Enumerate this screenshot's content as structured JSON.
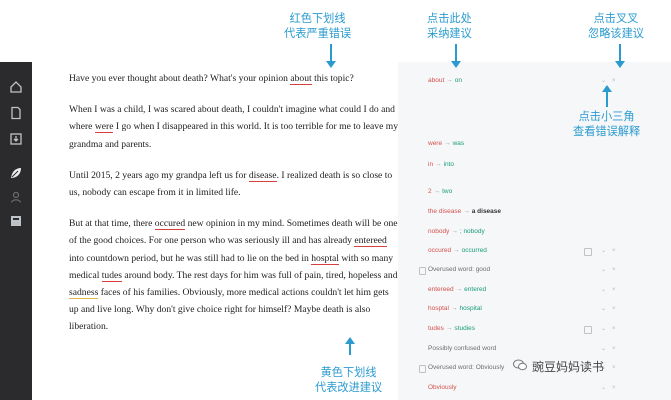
{
  "annotations": {
    "red_underline": [
      "红色下划线",
      "代表严重错误"
    ],
    "accept": [
      "点击此处",
      "采纳建议"
    ],
    "ignore": [
      "点击叉叉",
      "忽略该建议"
    ],
    "triangle": [
      "点击小三角",
      "查看错误解释"
    ],
    "yellow_underline": [
      "黄色下划线",
      "代表改进建议"
    ]
  },
  "paragraphs": [
    [
      "Have you ever thought about death? What's your opinion ",
      "about",
      " this topic?"
    ],
    [
      "When I was a child, I was scared about death, I couldn't imagine what could I do and where ",
      "were",
      " I go when I disappeared in this world. It is too terrible for me to leave my grandma and parents."
    ],
    [
      "Until 2015, 2 years ago my grandpa left us for ",
      "disease",
      ". I realized death is so close to us, nobody can escape from it in limited life."
    ],
    [
      "But at that time, there ",
      "occured",
      " new opinion in my mind. Sometimes death will be one of the good choices. For one person who was seriously ill and has already ",
      "entereed",
      " into countdown period, but he was still had to lie on the bed in ",
      "hosptal",
      " with so many medical ",
      "tudes",
      " around body. The rest days for him was full of pain, tired, hopeless and ",
      "sadness",
      " faces of his families. Obviously, more medical actions couldn't let him gets up and live long. Why don't give choice right for himself? Maybe death is also liberation."
    ]
  ],
  "suggestions": [
    {
      "from": "about",
      "to": "on"
    },
    {
      "from": "were",
      "to": "was"
    },
    {
      "from": "in",
      "to": "into"
    },
    {
      "from": "2",
      "to": "two"
    },
    {
      "from": "the disease",
      "to": "a disease"
    },
    {
      "from": "nobody",
      "to": "; nobody"
    },
    {
      "from": "occured",
      "to": "occurred"
    },
    {
      "label": "Overused word: ",
      "value": "good"
    },
    {
      "from": "entereed",
      "to": "entered"
    },
    {
      "from": "hosptal",
      "to": "hospital"
    },
    {
      "from": "tudes",
      "to": "studies"
    },
    {
      "label": "Possibly confused word",
      "value": ""
    },
    {
      "label": "Overused word: ",
      "value": "Obviously"
    },
    {
      "label": "Obviously",
      "value": ""
    }
  ],
  "controls": {
    "expand": "⌄",
    "dismiss": "×",
    "arrow": "→"
  },
  "watermark": "豌豆妈妈读书",
  "icons": [
    "home-icon",
    "document-icon",
    "download-icon",
    "leaf-icon",
    "person-icon",
    "book-icon"
  ],
  "colors": {
    "red": "#d4524f",
    "green": "#1b9c7a",
    "annotation": "#2b9bcf",
    "rail": "#2b2b2e"
  }
}
